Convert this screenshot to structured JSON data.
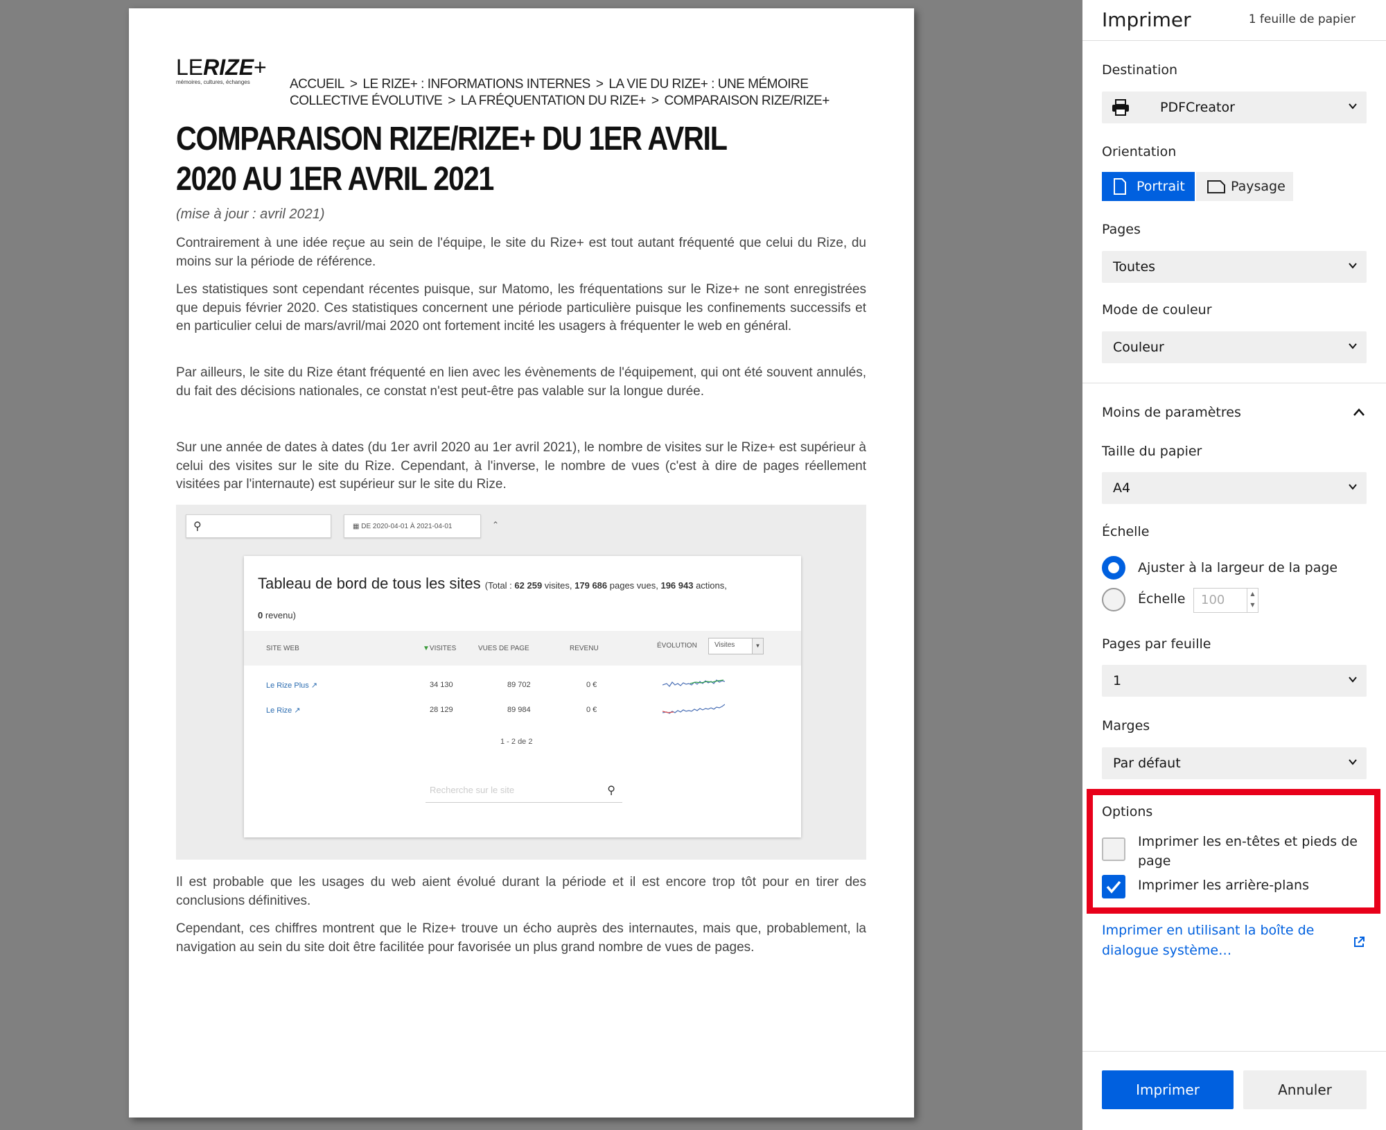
{
  "document": {
    "logo": {
      "main_prefix": "LE",
      "main_bold": "RIZE",
      "main_suffix": "+",
      "tagline": "mémoires, cultures, échanges"
    },
    "breadcrumb": [
      "Accueil",
      "Le Rize+ : informations internes",
      "La vie du Rize+ : une mémoire collective évolutive",
      "La fréquentation du Rize+",
      "Comparaison Rize/Rize+"
    ],
    "breadcrumb_sep": ">",
    "title": "COMPARAISON RIZE/RIZE+ DU 1ER AVRIL 2020 AU 1ER AVRIL 2021",
    "update_note": "(mise à jour : avril 2021)",
    "paragraphs": [
      "Contrairement à une idée reçue au sein de l'équipe, le site du Rize+ est tout autant fréquenté que celui du Rize, du moins sur la période de référence.",
      "Les statistiques sont cependant récentes puisque, sur Matomo, les fréquentations sur le Rize+ ne sont enregistrées que depuis février 2020. Ces statistiques concernent une période particulière puisque les confinements successifs et en particulier celui de mars/avril/mai 2020 ont fortement incité les usagers à fréquenter le web en général.",
      "Par ailleurs, le site du Rize étant fréquenté en lien avec les évènements de l'équipement, qui ont été souvent annulés, du fait des décisions nationales, ce constat n'est peut-être pas valable sur la longue durée.",
      "Sur une année de dates à dates (du 1er avril 2020 au 1er avril 2021), le nombre de visites sur le Rize+ est supérieur à celui des visites sur le site du Rize. Cependant, à l'inverse, le nombre de vues (c'est à dire de pages réellement visitées par l'internaute) est supérieur sur le site du Rize.",
      "Il est probable que les usages du web aient évolué durant la période et il est encore trop tôt pour en tirer des conclusions définitives.",
      "Cependant, ces chiffres montrent que le Rize+ trouve un écho auprès des internautes, mais que, probablement, la navigation au sein du site doit être facilitée pour favorisée un plus grand nombre de vues de pages."
    ],
    "screenshot": {
      "date_range": "DE 2020-04-01 À 2021-04-01",
      "dashboard_title": "Tableau de bord de tous les sites",
      "totals_prefix": "(Total : ",
      "totals_visits": "62 259",
      "totals_visits_label": " visites, ",
      "totals_pages": "179 686",
      "totals_pages_label": " pages vues, ",
      "totals_actions": "196 943",
      "totals_actions_label": " actions, ",
      "totals_revenue": "0",
      "totals_revenue_label": " revenu)",
      "columns": [
        "SITE WEB",
        "VISITES",
        "VUES DE PAGE",
        "REVENU",
        "ÉVOLUTION"
      ],
      "evolution_select": "Visites",
      "rows": [
        {
          "site": "Le Rize Plus",
          "visits": "34 130",
          "pageviews": "89 702",
          "revenue": "0 €"
        },
        {
          "site": "Le Rize",
          "visits": "28 129",
          "pageviews": "89 984",
          "revenue": "0 €"
        }
      ],
      "pager": "1 - 2 de 2",
      "site_search_placeholder": "Recherche sur le site"
    }
  },
  "panel": {
    "title": "Imprimer",
    "sheet_count": "1 feuille de papier",
    "destination_label": "Destination",
    "destination_value": "PDFCreator",
    "orientation_label": "Orientation",
    "portrait": "Portrait",
    "landscape": "Paysage",
    "pages_label": "Pages",
    "pages_value": "Toutes",
    "color_label": "Mode de couleur",
    "color_value": "Couleur",
    "less_settings": "Moins de paramètres",
    "paper_label": "Taille du papier",
    "paper_value": "A4",
    "scale_label": "Échelle",
    "fit_width": "Ajuster à la largeur de la page",
    "scale_option": "Échelle",
    "scale_value": "100",
    "pages_per_sheet_label": "Pages par feuille",
    "pages_per_sheet_value": "1",
    "margins_label": "Marges",
    "margins_value": "Par défaut",
    "options_label": "Options",
    "headers_footers": "Imprimer les en-têtes et pieds de page",
    "headers_footers_checked": false,
    "backgrounds": "Imprimer les arrière-plans",
    "backgrounds_checked": true,
    "system_dialog_link": "Imprimer en utilisant la boîte de dialogue système…",
    "print_button": "Imprimer",
    "cancel_button": "Annuler"
  },
  "colors": {
    "accent": "#0060df",
    "highlight": "#e8001a"
  }
}
